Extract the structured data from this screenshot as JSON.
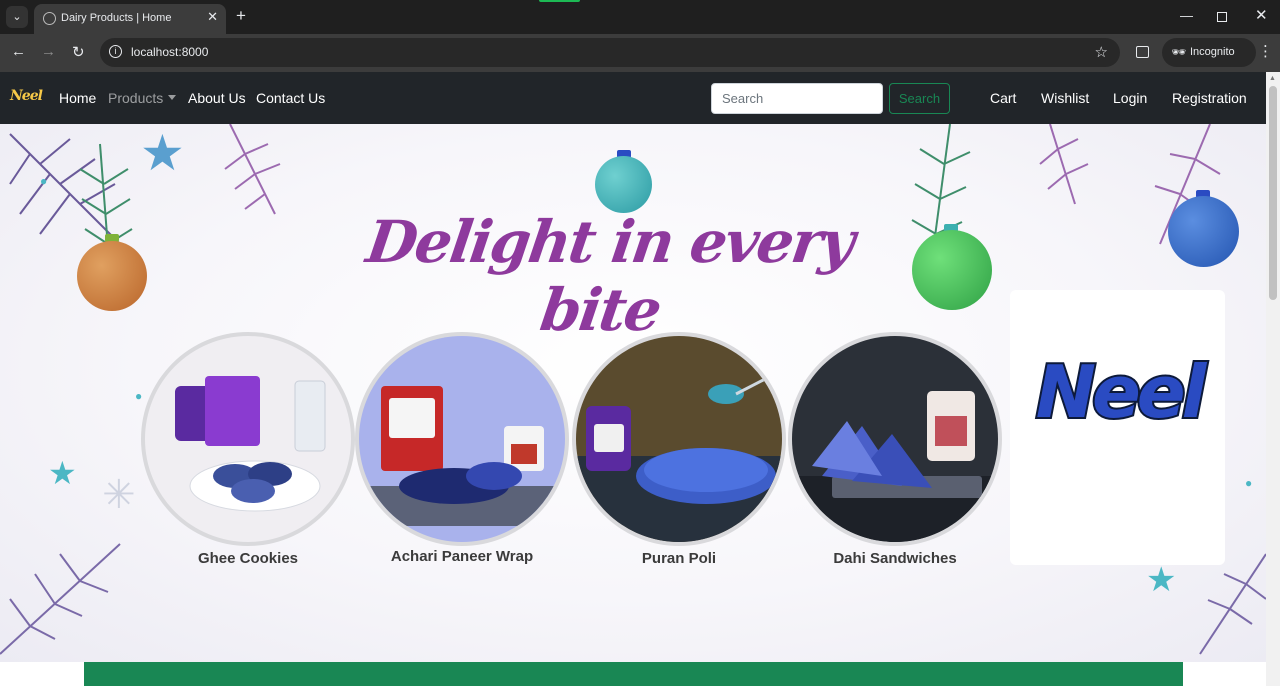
{
  "browser": {
    "tab_title": "Dairy Products | Home",
    "url": "localhost:8000",
    "incognito_label": "Incognito"
  },
  "navbar": {
    "brand": "Neel",
    "links": [
      "Home",
      "Products",
      "About Us",
      "Contact Us"
    ],
    "search_placeholder": "Search",
    "search_button": "Search",
    "right_links": [
      "Cart",
      "Wishlist",
      "Login",
      "Registration"
    ]
  },
  "hero": {
    "headline": "Delight in every bite",
    "products": [
      {
        "name": "Ghee Cookies",
        "bg": "#f0eef2"
      },
      {
        "name": "Achari Paneer Wrap",
        "bg": "#a9b2ec"
      },
      {
        "name": "Puran Poli",
        "bg": "#5a4b2e"
      },
      {
        "name": "Dahi Sandwiches",
        "bg": "#2b3038"
      }
    ],
    "logo_text": "Neel"
  },
  "colors": {
    "navbar_bg": "#212529",
    "headline": "#8e3a9d",
    "accent_green": "#198754",
    "logo_blue": "#2a4bc2",
    "logo_green": "#3ccf83"
  }
}
